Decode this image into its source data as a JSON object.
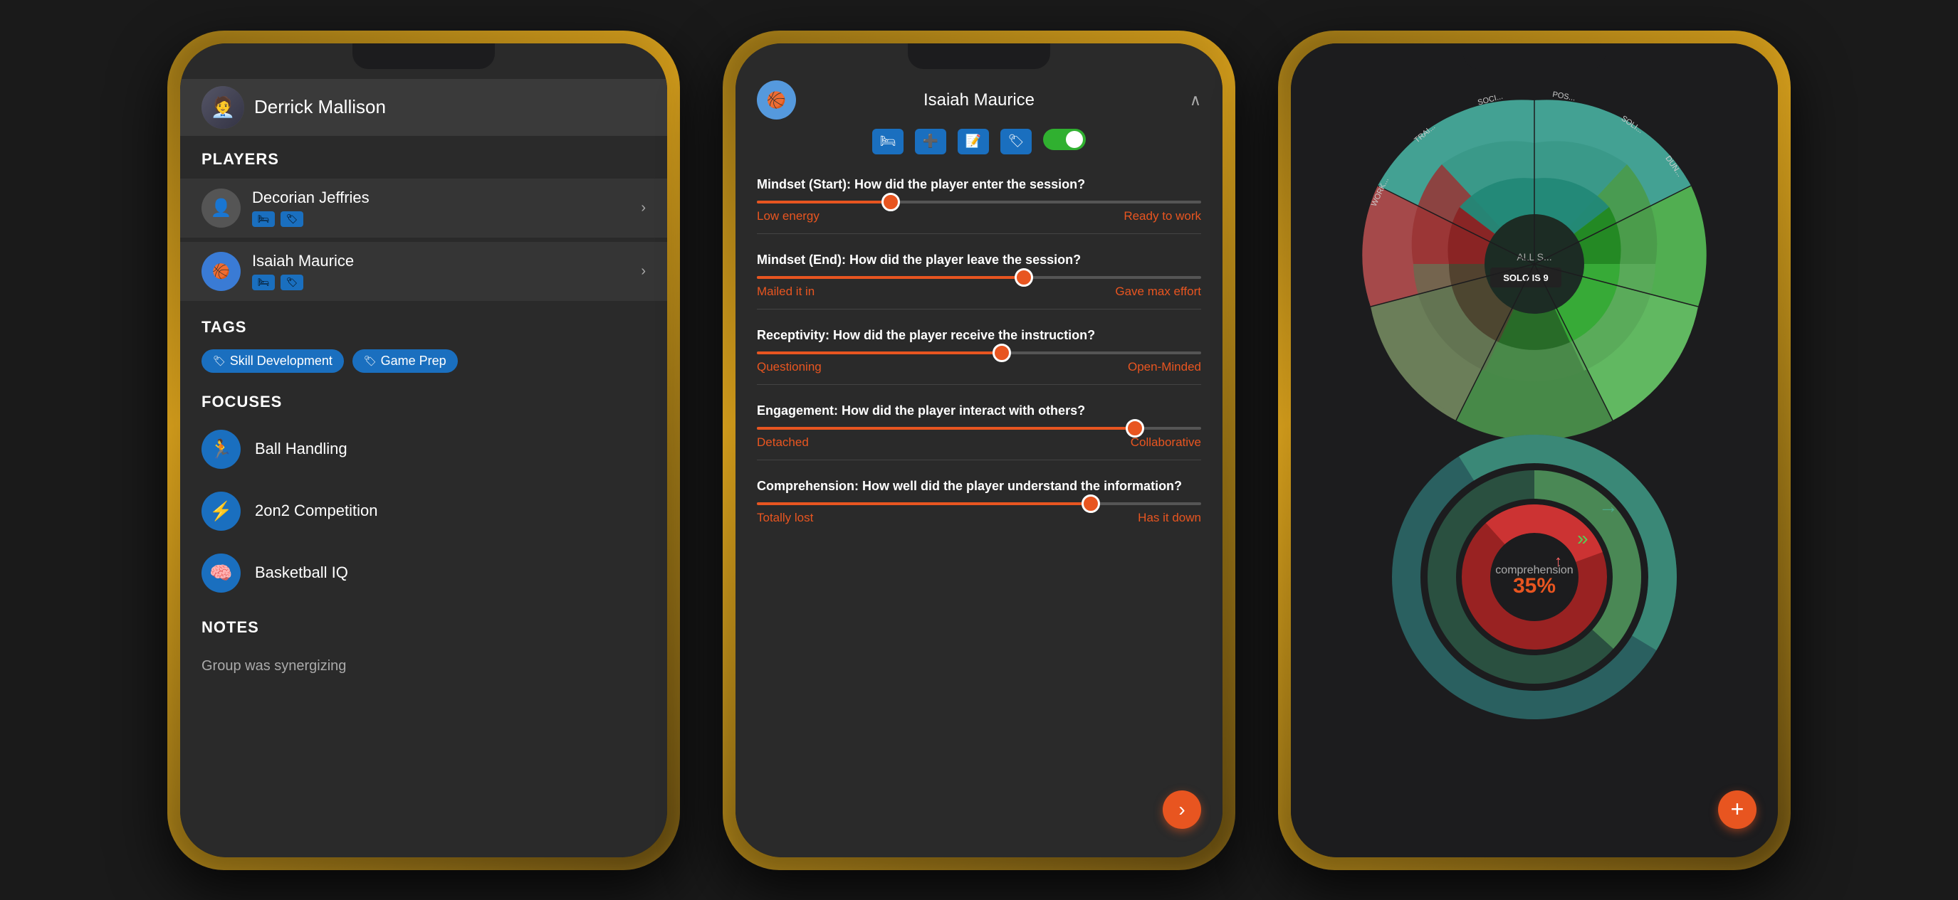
{
  "phone1": {
    "coach": {
      "name": "Derrick Mallison",
      "avatar": "👤"
    },
    "sections": {
      "players": "PLAYERS",
      "tags": "TAGS",
      "focuses": "FOCUSES",
      "notes": "NOTES"
    },
    "players": [
      {
        "name": "Decorian Jeffries",
        "avatar": "👤"
      },
      {
        "name": "Isaiah Maurice",
        "avatar": "🏀"
      }
    ],
    "tags": [
      "Skill Development",
      "Game Prep"
    ],
    "focuses": [
      {
        "name": "Ball Handling",
        "icon": "🏃"
      },
      {
        "name": "2on2 Competition",
        "icon": "⚡"
      },
      {
        "name": "Basketball IQ",
        "icon": "🧠"
      }
    ],
    "notes_text": "Group was synergizing"
  },
  "phone2": {
    "player_name": "Isaiah Maurice",
    "sliders": [
      {
        "label": "Mindset (Start)",
        "description": "How did the player enter the session?",
        "left": "Low energy",
        "right": "Ready to work",
        "value": 30
      },
      {
        "label": "Mindset (End)",
        "description": "How did the player leave the session?",
        "left": "Mailed it in",
        "right": "Gave max effort",
        "value": 60
      },
      {
        "label": "Receptivity",
        "description": "How did the player receive the instruction?",
        "left": "Questioning",
        "right": "Open-Minded",
        "value": 55
      },
      {
        "label": "Engagement",
        "description": "How did the player interact with others?",
        "left": "Detached",
        "right": "Collaborative",
        "value": 85
      },
      {
        "label": "Comprehension",
        "description": "How well did the player understand the information?",
        "left": "Totally lost",
        "right": "Has it down",
        "value": 75
      }
    ]
  },
  "phone3": {
    "comprehension_pct": "35%",
    "comprehension_label": "comprehension",
    "chart_label": "ALL S...",
    "solo_label": "SOLO IS 9"
  }
}
